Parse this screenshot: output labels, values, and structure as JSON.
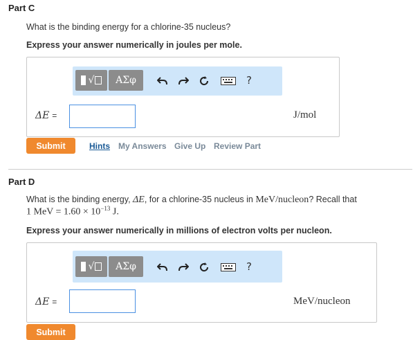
{
  "partC": {
    "title": "Part C",
    "question": "What is the binding energy for a chlorine-35 nucleus?",
    "instruction": "Express your answer numerically in joules per mole.",
    "toolbar": {
      "greek_label": "ΑΣφ",
      "help_label": "?"
    },
    "var_symbol": "ΔE",
    "var_equals": "=",
    "input_value": "",
    "unit": "J/mol",
    "submit_label": "Submit",
    "links": {
      "hints": "Hints",
      "my_answers": "My Answers",
      "give_up": "Give Up",
      "review_part": "Review Part"
    }
  },
  "partD": {
    "title": "Part D",
    "question_pre": "What is the binding energy, ",
    "question_var": "ΔE",
    "question_mid": ", for a chlorine-35 nucleus in ",
    "question_unit": "MeV/nucleon",
    "question_post": "? Recall that",
    "recall_lhs": "1 MeV = 1.60 × 10",
    "recall_exp": "−13",
    "recall_rhs": " J.",
    "instruction": "Express your answer numerically in millions of electron volts per nucleon.",
    "toolbar": {
      "greek_label": "ΑΣφ",
      "help_label": "?"
    },
    "var_symbol": "ΔE",
    "var_equals": "=",
    "input_value": "",
    "unit": "MeV/nucleon",
    "submit_label": "Submit"
  },
  "colors": {
    "toolbar_bg": "#cfe6fa",
    "submit_bg": "#f0892e",
    "input_border": "#4a90e2",
    "hints_link": "#1a5a96"
  }
}
